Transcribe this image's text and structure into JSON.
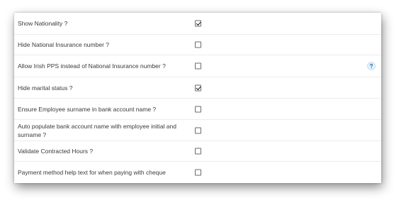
{
  "settings": [
    {
      "label": "Show Nationality ?",
      "checked": true
    },
    {
      "label": "Hide National Insurance number ?",
      "checked": false
    },
    {
      "label": "Allow Irish PPS instead of National Insurance number ?",
      "checked": false,
      "help_icon": "question-icon"
    },
    {
      "label": "Hide marital status ?",
      "checked": true
    },
    {
      "label": "Ensure Employee surname in bank account name ?",
      "checked": false
    },
    {
      "label": "Auto populate bank account name with employee initial and surname ?",
      "checked": false
    },
    {
      "label": "Validate Contracted Hours ?",
      "checked": false
    },
    {
      "label": "Payment method help text for when paying with cheque",
      "checked": false
    }
  ],
  "colors": {
    "help_icon": "#1e73be",
    "checkmark": "#111111"
  }
}
